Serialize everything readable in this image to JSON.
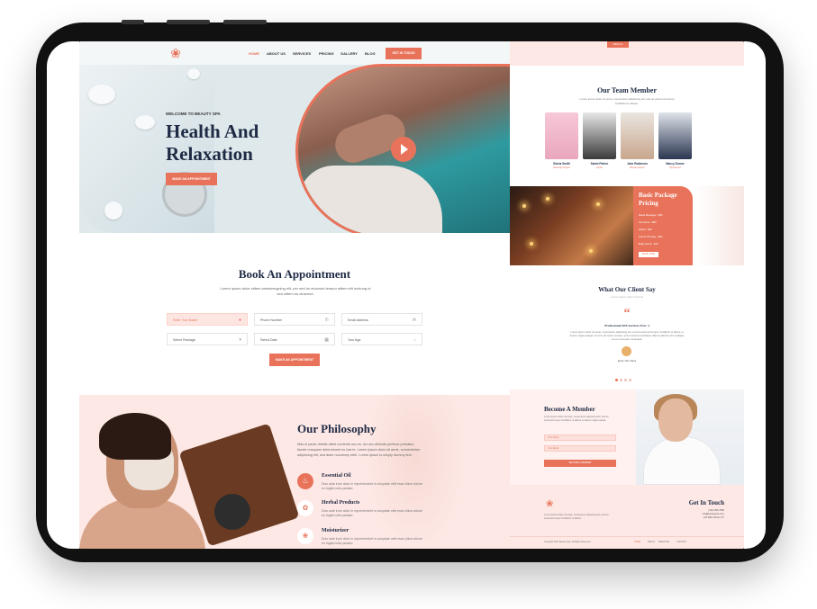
{
  "nav": {
    "items": [
      "HOME",
      "ABOUT US",
      "SERVICES",
      "PRICING",
      "GALLERY",
      "BLOG"
    ],
    "cta": "GET IN TOUCH"
  },
  "hero": {
    "eyebrow": "WELCOME TO BEAUTY SPA",
    "title": "Health And Relaxation",
    "button": "MAKE AN APPOINTMENT"
  },
  "booking": {
    "title": "Book An Appointment",
    "desc": "Lorem ipsum dolor sittem ametamcgning elit, per sed do eiusmod tempor sittem elit invirung ut sed sittem do eiusmod.",
    "fields": {
      "name": "Enter Your Name",
      "phone": "Phone Number",
      "email": "Email Address",
      "package": "Select Package",
      "date": "Select Date",
      "age": "Your Age"
    },
    "button": "MAKE AN APPOINTMENT"
  },
  "philosophy": {
    "title": "Our Philosophy",
    "desc": "Mas ei paulo debitis affert nominati usu eu. Ad usu delicata pertinax probatus facete nusquam deterruisset eu has te. Lorem ipsum dolor sit amet, consectetuer adipiscing elit, sed diam nonummy nibh. Lorem ipsum is simply dummy text.",
    "features": [
      {
        "title": "Essential Oil",
        "desc": "Duis aute irure dolor in reprehenderit in voluptate velit esse cillum dolore eu fugiat nulla pariatur."
      },
      {
        "title": "Herbal Products",
        "desc": "Duis aute irure dolor in reprehenderit in voluptate velit esse cillum dolore eu fugiat nulla pariatur."
      },
      {
        "title": "Moisturizer",
        "desc": "Duis aute irure dolor in reprehenderit in voluptate velit esse cillum dolore eu fugiat nulla pariatur."
      }
    ]
  },
  "team": {
    "top_button": "VIEW ALL",
    "title": "Our Team Member",
    "desc": "Lorem ipsum dolor sit amet, consectetur adipiscing elit, sed do eiusmod tempor incididunt ut labore.",
    "members": [
      {
        "name": "Gloria Smith",
        "role": "Massage Expert"
      },
      {
        "name": "Sarah Parker",
        "role": "Stylist"
      },
      {
        "name": "Jane Robinson",
        "role": "Beauty Expert"
      },
      {
        "name": "Nancy Drome",
        "role": "Spa Expert"
      }
    ]
  },
  "pricing": {
    "title": "Basic Package Pricing",
    "items": [
      "Relax Massage - $50",
      "Hot Stone - $80",
      "Facial - $40",
      "Aroma Therapy - $60",
      "Body Scrub - $70"
    ],
    "button": "BOOK NOW"
  },
  "testimonials": {
    "title": "What Our Client Say",
    "subtitle": "Lorem ipsum dolor sit amet",
    "quote_mark": "“",
    "heading": "Professional SPA Services Ever :)",
    "text": "Lorem ipsum dolor sit amet, consectetur adipiscing elit, sed do eiusmod tempor incididunt ut labore et dolore magna aliqua. Ut enim ad minim veniam, quis nostrud exercitation ullamco laboris nisi ut aliquip ex ea commodo consequat.",
    "name": "Emily Van Parks"
  },
  "membership": {
    "title": "Become A Member",
    "desc": "Lorem ipsum dolor sit amet, consectetur adipiscing elit, sed do eiusmod tempor incididunt ut labore et dolore magna aliqua.",
    "name_placeholder": "Your Name",
    "email_placeholder": "Your Email",
    "button": "BECOME A MEMBER"
  },
  "footer": {
    "desc": "Lorem ipsum dolor sit amet, consectetur adipiscing elit, sed do eiusmod tempor incididunt ut labore.",
    "contact_title": "Get In Touch",
    "contact_lines": [
      "(123) 456 7890",
      "info@beautyspa.com",
      "123 Main Street, NY"
    ],
    "copyright": "Copyright 2021 Beauty Spa. All Rights Reserved.",
    "links": [
      "HOME",
      "ABOUT",
      "SERVICES",
      "CONTACT"
    ]
  },
  "colors": {
    "accent": "#e8735a",
    "navy": "#1f2a44",
    "blush": "#fde8e5"
  }
}
